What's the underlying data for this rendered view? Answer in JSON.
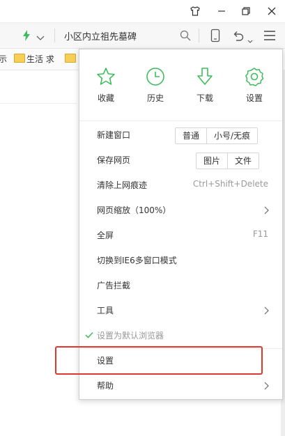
{
  "addressbar": {
    "query": "小区内立祖先墓碑"
  },
  "bookmarks": {
    "left_fragment": "示",
    "folder1": "生活 求"
  },
  "menu": {
    "quick": [
      {
        "label": "收藏",
        "icon": "star-icon"
      },
      {
        "label": "历史",
        "icon": "clock-icon"
      },
      {
        "label": "下载",
        "icon": "download-arrow-icon"
      },
      {
        "label": "设置",
        "icon": "gear-icon"
      }
    ],
    "new_window": {
      "label": "新建窗口",
      "options": [
        "普通",
        "小号/无痕"
      ]
    },
    "save_page": {
      "label": "保存网页",
      "options": [
        "图片",
        "文件"
      ]
    },
    "clear_traces": {
      "label": "清除上网痕迹",
      "shortcut": "Ctrl+Shift+Delete"
    },
    "zoom": {
      "label": "网页缩放（100%）"
    },
    "fullscreen": {
      "label": "全屏",
      "shortcut": "F11"
    },
    "ie6_mode": {
      "label": "切换到IE6多窗口模式"
    },
    "adblock": {
      "label": "广告拦截"
    },
    "tools": {
      "label": "工具"
    },
    "default_browser": {
      "label": "设置为默认浏览器"
    },
    "settings": {
      "label": "设置"
    },
    "help": {
      "label": "帮助"
    }
  },
  "colors": {
    "accent_green": "#3dbd5d",
    "highlight_red": "#e0362c"
  }
}
